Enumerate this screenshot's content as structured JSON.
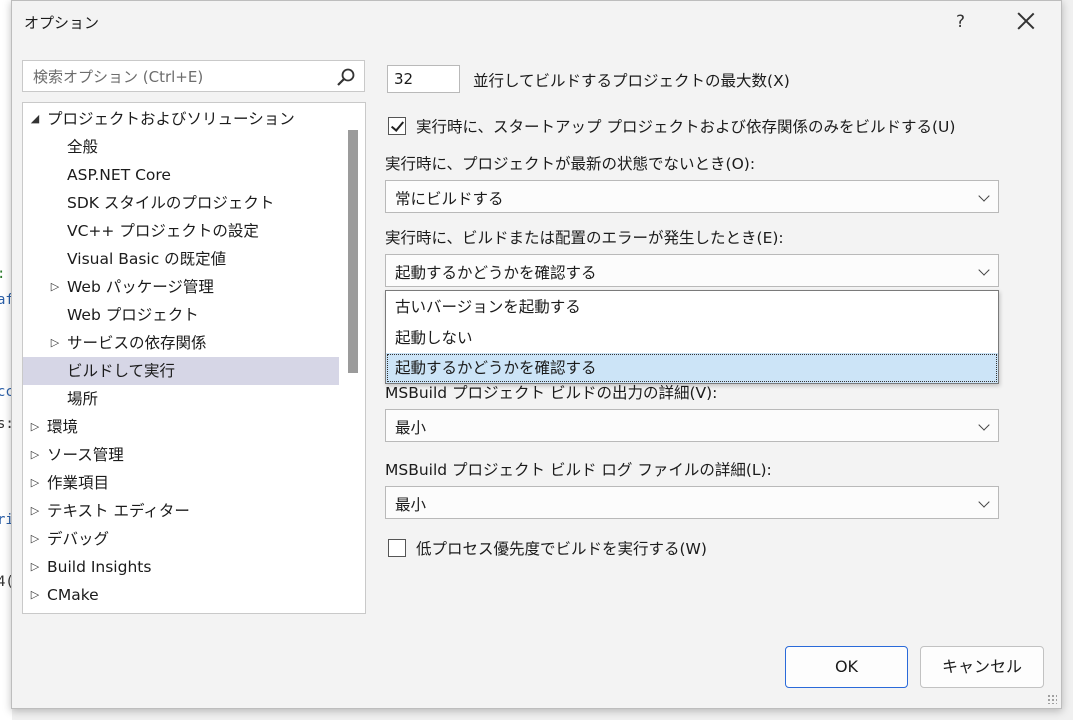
{
  "dialog": {
    "title": "オプション",
    "help_label": "?"
  },
  "search": {
    "placeholder": "検索オプション (Ctrl+E)"
  },
  "tree": {
    "items": [
      {
        "label": "プロジェクトおよびソリューション",
        "expander": "◢"
      },
      {
        "label": "全般",
        "expander": ""
      },
      {
        "label": "ASP.NET Core",
        "expander": ""
      },
      {
        "label": "SDK スタイルのプロジェクト",
        "expander": ""
      },
      {
        "label": "VC++ プロジェクトの設定",
        "expander": ""
      },
      {
        "label": "Visual Basic の既定値",
        "expander": ""
      },
      {
        "label": "Web パッケージ管理",
        "expander": "▷"
      },
      {
        "label": "Web プロジェクト",
        "expander": ""
      },
      {
        "label": "サービスの依存関係",
        "expander": "▷"
      },
      {
        "label": "ビルドして実行",
        "expander": ""
      },
      {
        "label": "場所",
        "expander": ""
      },
      {
        "label": "環境",
        "expander": "▷"
      },
      {
        "label": "ソース管理",
        "expander": "▷"
      },
      {
        "label": "作業項目",
        "expander": "▷"
      },
      {
        "label": "テキスト エディター",
        "expander": "▷"
      },
      {
        "label": "デバッグ",
        "expander": "▷"
      },
      {
        "label": "Build Insights",
        "expander": "▷"
      },
      {
        "label": "CMake",
        "expander": "▷"
      }
    ]
  },
  "form": {
    "max_parallel_value": "32",
    "max_parallel_label": "並行してビルドするプロジェクトの最大数(X)",
    "startup_only_label": "実行時に、スタートアップ プロジェクトおよび依存関係のみをビルドする(U)",
    "outdated_label": "実行時に、プロジェクトが最新の状態でないとき(O):",
    "outdated_value": "常にビルドする",
    "error_label": "実行時に、ビルドまたは配置のエラーが発生したとき(E):",
    "error_value": "起動するかどうかを確認する",
    "error_options": [
      "古いバージョンを起動する",
      "起動しない",
      "起動するかどうかを確認する"
    ],
    "msbuild_output_label": "MSBuild プロジェクト ビルドの出力の詳細(V):",
    "msbuild_output_value": "最小",
    "msbuild_log_label": "MSBuild プロジェクト ビルド ログ ファイルの詳細(L):",
    "msbuild_log_value": "最小",
    "low_priority_label": "低プロセス優先度でビルドを実行する(W)"
  },
  "buttons": {
    "ok": "OK",
    "cancel": "キャンセル"
  },
  "background_code": [
    ":",
    "af",
    "cc",
    "s:",
    "ri",
    "4("
  ]
}
